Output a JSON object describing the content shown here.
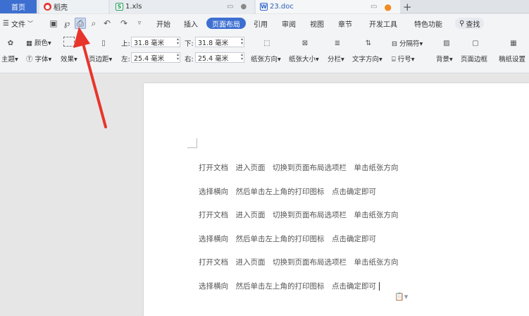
{
  "tabs": {
    "home": "首页",
    "docer": "稻壳",
    "xls": "1.xls",
    "doc": "23.doc",
    "new_tab": "+"
  },
  "menubar": {
    "file": "文件",
    "items": [
      "开始",
      "插入",
      "页面布局",
      "引用",
      "审阅",
      "视图",
      "章节",
      "开发工具",
      "特色功能"
    ],
    "active": "页面布局",
    "search": "查找"
  },
  "ribbon": {
    "theme": "主题",
    "color": "颜色",
    "font": "字体",
    "effect": "效果",
    "margin": "页边距",
    "top_label": "上:",
    "top_value": "31.8 毫米",
    "bottom_label": "下:",
    "bottom_value": "31.8 毫米",
    "left_label": "左:",
    "left_value": "25.4 毫米",
    "right_label": "右:",
    "right_value": "25.4 毫米",
    "orientation": "纸张方向",
    "size": "纸张大小",
    "columns": "分栏",
    "text_direction": "文字方向",
    "separator": "分隔符",
    "line_number": "行号",
    "background": "背景",
    "page_border": "页面边框",
    "manuscript": "稿纸设置"
  },
  "document": {
    "lines": [
      "打开文档　进入页面　切换到页面布局选项栏　单击纸张方向",
      "选择横向　然后单击左上角的打印图标　点击确定即可",
      "打开文档　进入页面　切换到页面布局选项栏　单击纸张方向",
      "选择横向　然后单击左上角的打印图标　点击确定即可",
      "打开文档　进入页面　切换到页面布局选项栏　单击纸张方向",
      "选择横向　然后单击左上角的打印图标　点击确定即可"
    ]
  },
  "colors": {
    "accent": "#3d6fd1",
    "arrow": "#e8352c"
  }
}
